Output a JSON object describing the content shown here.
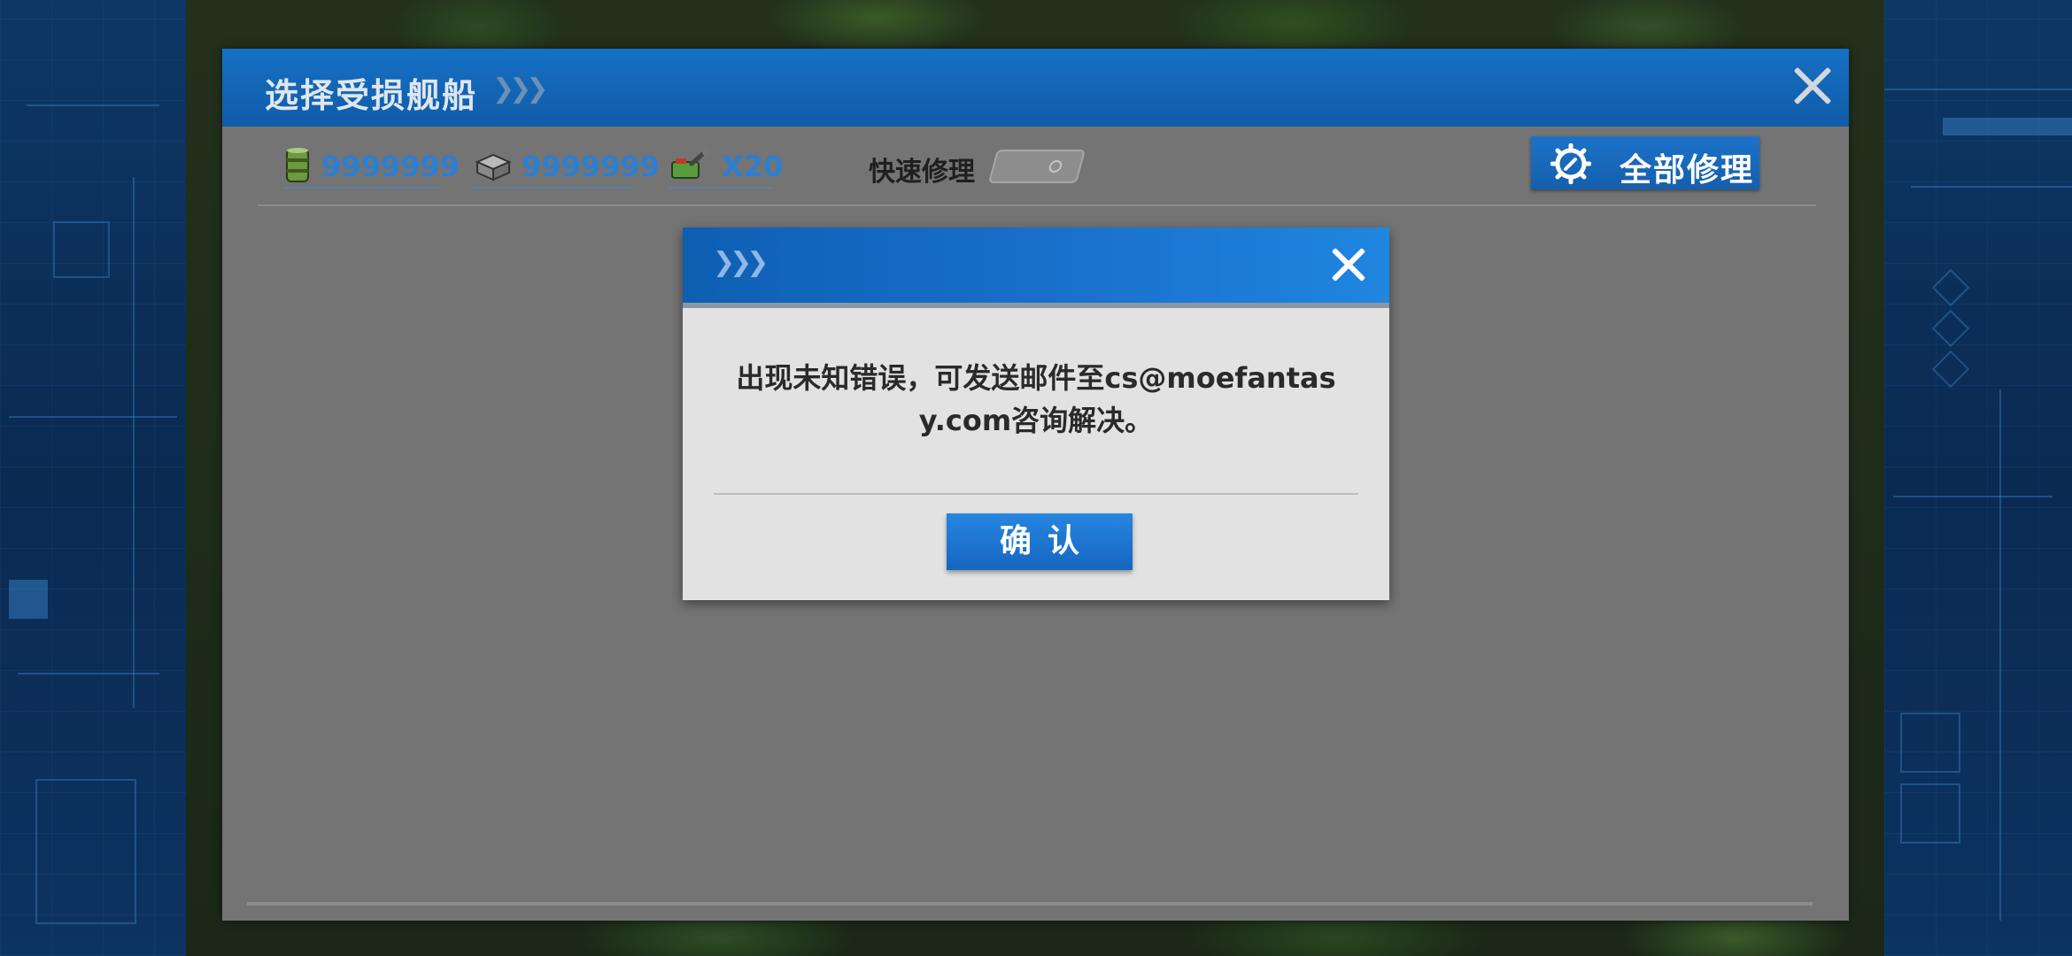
{
  "panel": {
    "title": "选择受损舰船",
    "title_chevrons": "❯❯❯",
    "resources": [
      {
        "icon": "fuel-barrel-icon",
        "value": "9999999"
      },
      {
        "icon": "ammo-crate-icon",
        "value": "9999999"
      },
      {
        "icon": "repair-kit-icon",
        "value": "X20"
      }
    ],
    "quick_repair_label": "快速修理",
    "quick_repair_on": false,
    "repair_all_label": "全部修理"
  },
  "dialog": {
    "header_chevrons": "❯❯❯",
    "message_line1": "出现未知错误，可发送邮件至cs@moefantas",
    "message_line2": "y.com咨询解决。",
    "confirm_label": "确认"
  },
  "colors": {
    "accent_blue": "#1670c4",
    "resource_value": "#2b7fd3",
    "panel_bg": "#747474",
    "dialog_bg": "#e2e2e2"
  }
}
